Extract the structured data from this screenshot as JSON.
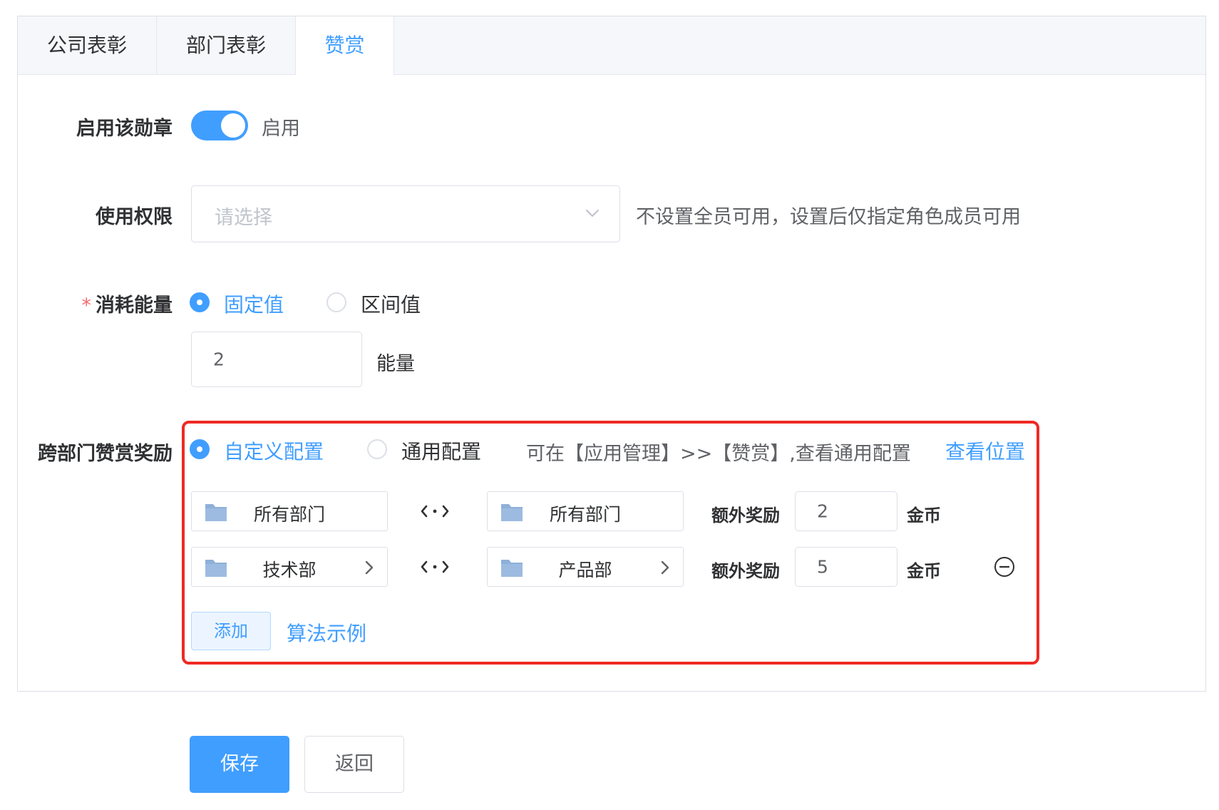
{
  "tabs": [
    {
      "label": "公司表彰",
      "active": false
    },
    {
      "label": "部门表彰",
      "active": false
    },
    {
      "label": "赞赏",
      "active": true
    }
  ],
  "enable": {
    "label": "启用该勋章",
    "switch_on": true,
    "switch_text": "启用"
  },
  "permission": {
    "label": "使用权限",
    "placeholder": "请选择",
    "hint": "不设置全员可用，设置后仅指定角色成员可用"
  },
  "energy": {
    "required_mark": "*",
    "label": "消耗能量",
    "options": [
      {
        "label": "固定值",
        "checked": true
      },
      {
        "label": "区间值",
        "checked": false
      }
    ],
    "value": "2",
    "unit": "能量"
  },
  "cross_dept": {
    "label": "跨部门赞赏奖励",
    "options": [
      {
        "label": "自定义配置",
        "checked": true
      },
      {
        "label": "通用配置",
        "checked": false
      }
    ],
    "info": "可在【应用管理】>>【赞赏】,查看通用配置",
    "view_link": "查看位置",
    "rows": [
      {
        "from": "所有部门",
        "to": "所有部门",
        "reward_label": "额外奖励",
        "amount": "2",
        "unit": "金币"
      },
      {
        "from": "技术部",
        "to": "产品部",
        "reward_label": "额外奖励",
        "amount": "5",
        "unit": "金币"
      }
    ],
    "add_label": "添加",
    "example_link": "算法示例"
  },
  "footer": {
    "save_label": "保存",
    "back_label": "返回"
  },
  "colors": {
    "primary": "#409eff",
    "highlight_border": "#ee2a24",
    "required": "#f56c6c",
    "folder": "#8eb0d9"
  }
}
